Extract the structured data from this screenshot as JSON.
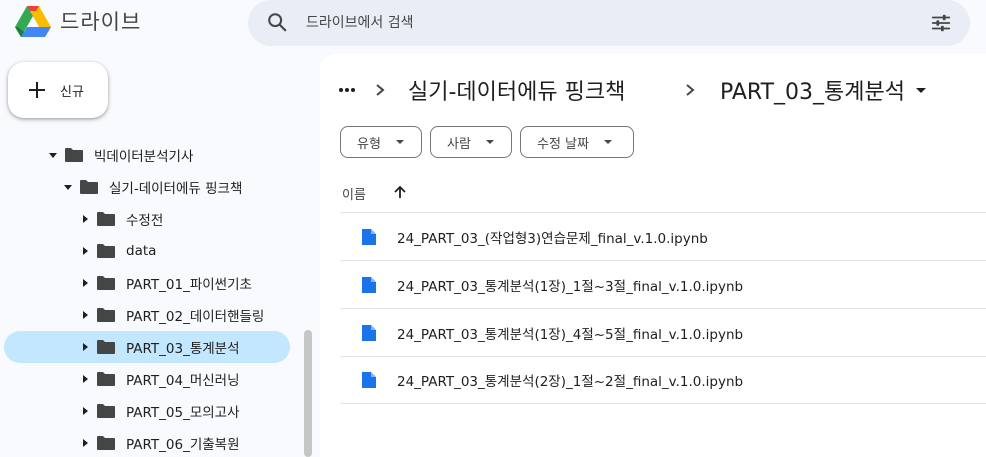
{
  "header": {
    "app_title": "드라이브",
    "search_placeholder": "드라이브에서 검색"
  },
  "new_button": {
    "label": "신규"
  },
  "sidebar": {
    "tree": [
      {
        "label": "빅데이터분석기사",
        "level": 0,
        "expanded": true,
        "selected": false
      },
      {
        "label": "실기-데이터에듀 핑크책",
        "level": 1,
        "expanded": true,
        "selected": false
      },
      {
        "label": "수정전",
        "level": 2,
        "expanded": false,
        "selected": false
      },
      {
        "label": "data",
        "level": 2,
        "expanded": false,
        "selected": false
      },
      {
        "label": "PART_01_파이썬기초",
        "level": 2,
        "expanded": false,
        "selected": false
      },
      {
        "label": "PART_02_데이터핸들링",
        "level": 2,
        "expanded": false,
        "selected": false
      },
      {
        "label": "PART_03_통계분석",
        "level": 2,
        "expanded": false,
        "selected": true
      },
      {
        "label": "PART_04_머신러닝",
        "level": 2,
        "expanded": false,
        "selected": false
      },
      {
        "label": "PART_05_모의고사",
        "level": 2,
        "expanded": false,
        "selected": false
      },
      {
        "label": "PART_06_기출복원",
        "level": 2,
        "expanded": false,
        "selected": false
      }
    ]
  },
  "breadcrumb": {
    "items": [
      "실기-데이터에듀 핑크책",
      "PART_03_통계분석"
    ]
  },
  "filters": {
    "type_label": "유형",
    "people_label": "사람",
    "modified_label": "수정 날짜"
  },
  "list": {
    "column_name": "이름",
    "sort": "ascending",
    "files": [
      {
        "name": "24_PART_03_(작업형3)연습문제_final_v.1.0.ipynb"
      },
      {
        "name": "24_PART_03_통계분석(1장)_1절~3절_final_v.1.0.ipynb"
      },
      {
        "name": "24_PART_03_통계분석(1장)_4절~5절_final_v.1.0.ipynb"
      },
      {
        "name": "24_PART_03_통계분석(2장)_1절~2절_final_v.1.0.ipynb"
      }
    ]
  },
  "colors": {
    "background": "#f8fafd",
    "search_bg": "#e9eef6",
    "selected_bg": "#c2e7ff",
    "file_icon": "#1a73e8"
  }
}
